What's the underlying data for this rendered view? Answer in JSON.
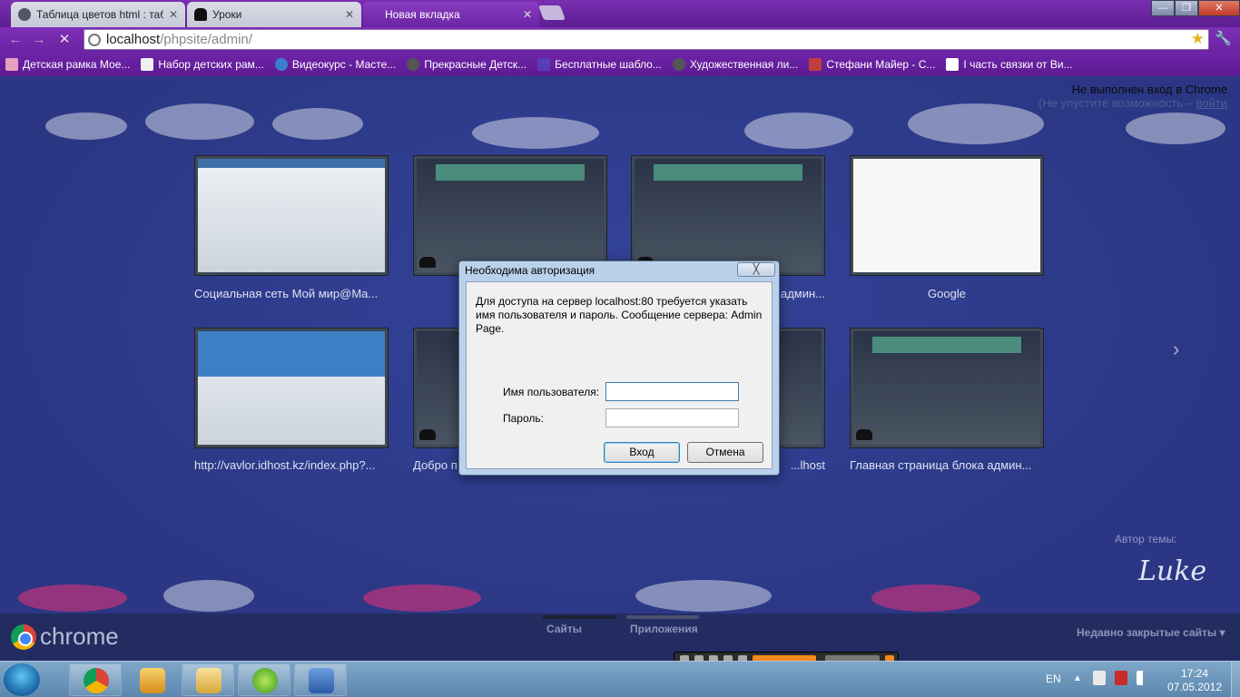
{
  "tabs": [
    {
      "title": "Таблица цветов html : таб",
      "active": false
    },
    {
      "title": "Уроки",
      "active": false
    },
    {
      "title": "Новая вкладка",
      "active": true
    }
  ],
  "omnibox": {
    "host": "localhost",
    "path": "/phpsite/admin/"
  },
  "bookmarks": [
    "Детская рамка Мое...",
    "Набор детских рам...",
    "Видеокурс - Масте...",
    "Прекрасные Детск...",
    "Бесплатные шабло...",
    "Художественная ли...",
    "Стефани Майер - С...",
    "I часть связки от Ви..."
  ],
  "login_status": {
    "line1": "Не выполнен вход в Chrome",
    "line2_prefix": "(Не упустите возможность – ",
    "line2_link": "войти"
  },
  "thumbnails": [
    {
      "label": "Социальная сеть Мой мир@Ma..."
    },
    {
      "label": ""
    },
    {
      "label": "...админ..."
    },
    {
      "label": "Google"
    },
    {
      "label": "http://vavlor.idhost.kz/index.php?..."
    },
    {
      "label": "Добро п..."
    },
    {
      "label": "...lhost"
    },
    {
      "label": "Главная страница блока админ..."
    }
  ],
  "theme": {
    "author_label": "Автор темы:",
    "signature": "Luke"
  },
  "bottom": {
    "brand": "chrome",
    "tab_sites": "Сайты",
    "tab_apps": "Приложения",
    "recent": "Недавно закрытые сайты"
  },
  "dialog": {
    "title": "Необходима авторизация",
    "close": "╳",
    "message": "Для доступа на сервер localhost:80 требуется указать имя пользователя и пароль. Сообщение сервера: Admin Page.",
    "username_label": "Имя пользователя:",
    "password_label": "Пароль:",
    "username_value": "",
    "password_value": "",
    "ok": "Вход",
    "cancel": "Отмена"
  },
  "taskbar": {
    "lang": "EN",
    "time": "17:24",
    "date": "07.05.2012"
  },
  "icons": {
    "back": "back-arrow-icon",
    "forward": "forward-arrow-icon",
    "reload": "stop-icon",
    "star": "star-icon",
    "wrench": "wrench-icon"
  },
  "colors": {
    "tabstrip": "#6a24a2",
    "ntp_bg": "#2d3a88",
    "dialog_frame": "#b9d1ea"
  }
}
